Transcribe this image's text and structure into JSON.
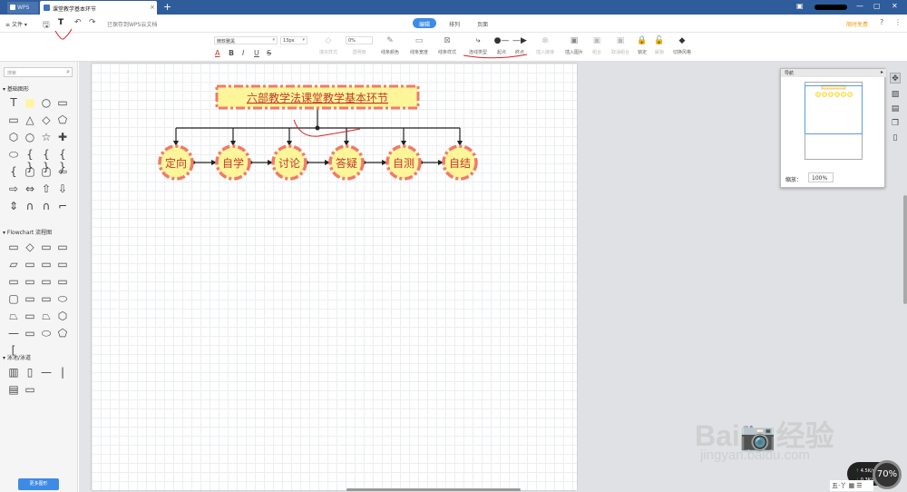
{
  "titlebar": {
    "wps_tab": "WPS",
    "doc_tab": "课堂教学基本环节",
    "close": "×",
    "new_tab": "+",
    "win_min": "—",
    "win_max": "▢",
    "win_close": "✕"
  },
  "menubar": {
    "file": "文件",
    "file_arrow": "▾",
    "saved": "已保存到WPS云文档",
    "tabs": [
      "编辑",
      "排列",
      "页面"
    ],
    "active_tab": "编辑",
    "free_trial": "限时免费",
    "help": "?",
    "more": "⋮"
  },
  "toolbar": {
    "font": "微软雅黑",
    "font_size": "13px",
    "opacity": "0%",
    "format": [
      "A",
      "B",
      "I",
      "U",
      "S"
    ],
    "tools": [
      {
        "label": "填充样式",
        "icon": "◇",
        "enabled": false
      },
      {
        "label": "透明度",
        "icon": "",
        "enabled": false
      },
      {
        "label": "线条颜色",
        "icon": "✎",
        "enabled": true
      },
      {
        "label": "线条宽度",
        "icon": "▭",
        "enabled": true
      },
      {
        "label": "线条样式",
        "icon": "⊠",
        "enabled": true
      },
      {
        "label": "连线类型",
        "icon": "⤷",
        "enabled": true
      },
      {
        "label": "起点",
        "icon": "●—",
        "enabled": true
      },
      {
        "label": "终点",
        "icon": "—▶",
        "enabled": true
      },
      {
        "label": "插入链接",
        "icon": "⊗",
        "enabled": false
      },
      {
        "label": "插入图片",
        "icon": "▣",
        "enabled": true
      },
      {
        "label": "组合",
        "icon": "▣",
        "enabled": false
      },
      {
        "label": "取消组合",
        "icon": "▣",
        "enabled": false
      },
      {
        "label": "锁定",
        "icon": "🔒",
        "enabled": true
      },
      {
        "label": "解锁",
        "icon": "🔓",
        "enabled": false
      },
      {
        "label": "切换风格",
        "icon": "◆",
        "enabled": true
      }
    ]
  },
  "sidebar": {
    "search_placeholder": "搜索",
    "categories": [
      "基础图形",
      "Flowchart 流程图",
      "泳池/泳道"
    ],
    "more_shapes": "更多图形",
    "basic_shapes": [
      "T",
      "■",
      "○",
      "▭",
      "▭",
      "△",
      "◇",
      "⬠",
      "⬡",
      "○",
      "☆",
      "✚",
      "⬭",
      "{ }",
      "{ }",
      "{ }",
      "{",
      "▢",
      "▢",
      "⇦",
      "⇨",
      "⇔",
      "⇧",
      "⇩",
      "⇕",
      "∩",
      "∩",
      "⌐"
    ],
    "flow_shapes": [
      "▭",
      "◇",
      "▭",
      "▭",
      "▱",
      "▭",
      "▭",
      "▭",
      "▭",
      "▭",
      "▭",
      "▭",
      "▢",
      "▭",
      "▭",
      "⬭",
      "⏢",
      "▭",
      "⏢",
      "⬡",
      "—",
      "▭",
      "⬭",
      "⬠",
      "["
    ],
    "swim_shapes": [
      "▥",
      "▯",
      "—",
      "|",
      "▤",
      "▭"
    ]
  },
  "diagram": {
    "title": "六部教学法课堂教学基本环节",
    "nodes": [
      "定向",
      "自学",
      "讨论",
      "答疑",
      "自测",
      "自结"
    ],
    "colors": {
      "fill": "#fdf59a",
      "border": "#f17a6a",
      "text": "#c0392b"
    }
  },
  "navigator": {
    "title": "导航",
    "zoom_label": "缩放：",
    "zoom": "100%"
  },
  "watermark": {
    "brand": "Bai📷经验",
    "site": "jingyan.baidu.com"
  },
  "perf": {
    "up": "4.5K/s",
    "down": "0.3K/s",
    "percent": "70%"
  },
  "ime": {
    "label": "五·丫 ▦ ☰"
  }
}
